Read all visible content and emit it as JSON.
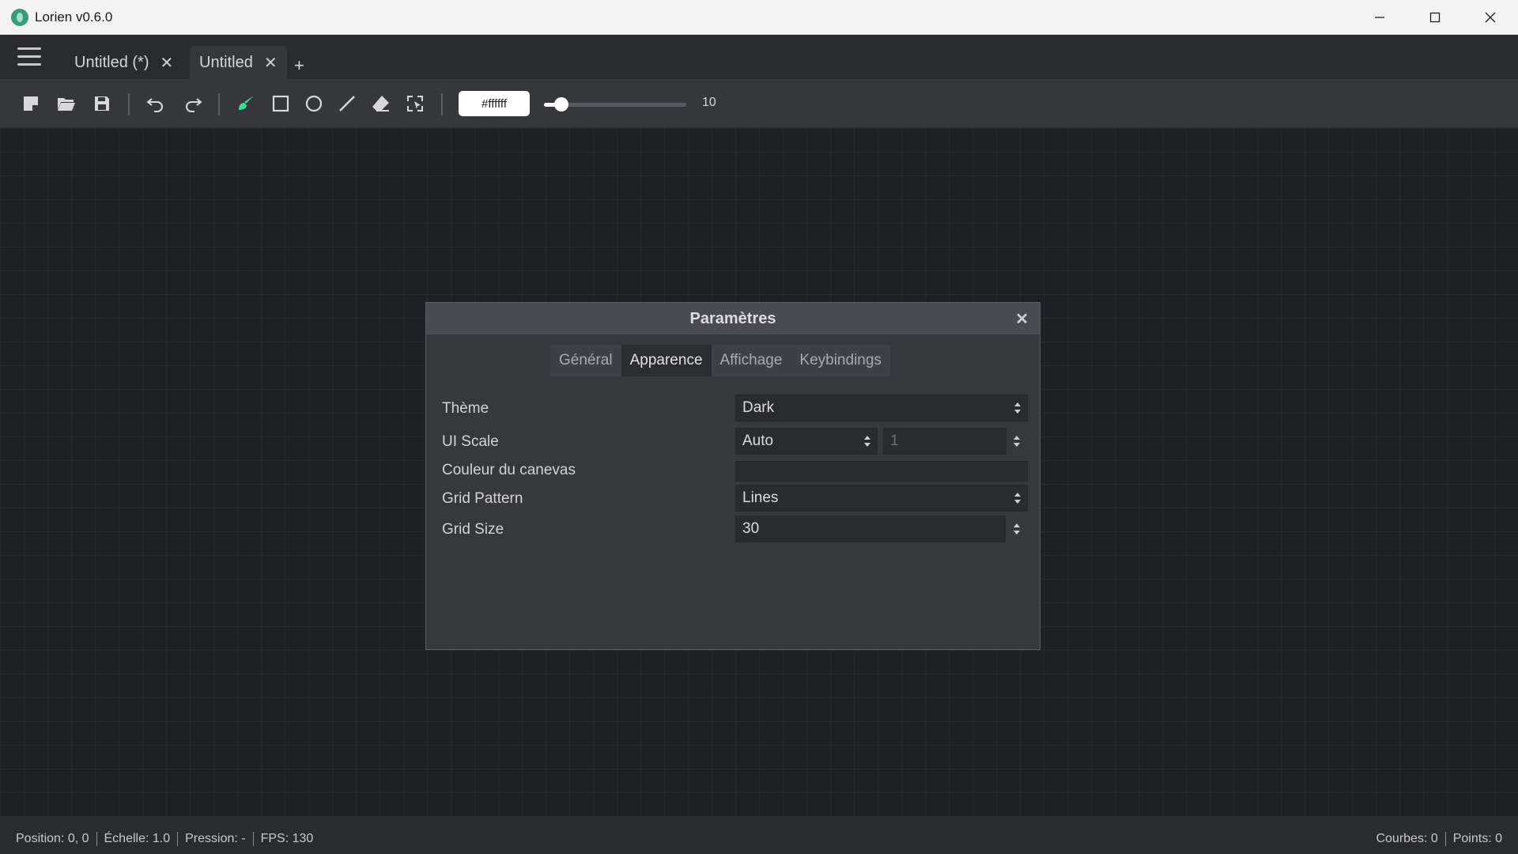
{
  "window": {
    "title": "Lorien v0.6.0"
  },
  "tabs": [
    {
      "label": "Untitled (*)",
      "active": false
    },
    {
      "label": "Untitled",
      "active": true
    }
  ],
  "toolbar": {
    "color_hex": "#ffffff",
    "brush_size": "10",
    "brush_size_fraction": 0.12,
    "active_tool": "brush-tool"
  },
  "dialog": {
    "title": "Paramètres",
    "tabs": [
      "Général",
      "Apparence",
      "Affichage",
      "Keybindings"
    ],
    "active_tab": "Apparence",
    "rows": {
      "theme": {
        "label": "Thème",
        "value": "Dark"
      },
      "ui_scale": {
        "label": "UI Scale",
        "mode": "Auto",
        "value": "1"
      },
      "canvas_color": {
        "label": "Couleur du canevas",
        "value": ""
      },
      "grid_pattern": {
        "label": "Grid Pattern",
        "value": "Lines"
      },
      "grid_size": {
        "label": "Grid Size",
        "value": "30"
      }
    }
  },
  "status": {
    "position": "Position: 0, 0",
    "scale": "Échelle: 1.0",
    "pressure": "Pression: -",
    "fps": "FPS: 130",
    "strokes": "Courbes: 0",
    "points": "Points: 0"
  },
  "colors": {
    "accent": "#3ddc97",
    "canvas": "#1f2023",
    "toolbar": "#36373b",
    "dialog": "#37383c"
  }
}
